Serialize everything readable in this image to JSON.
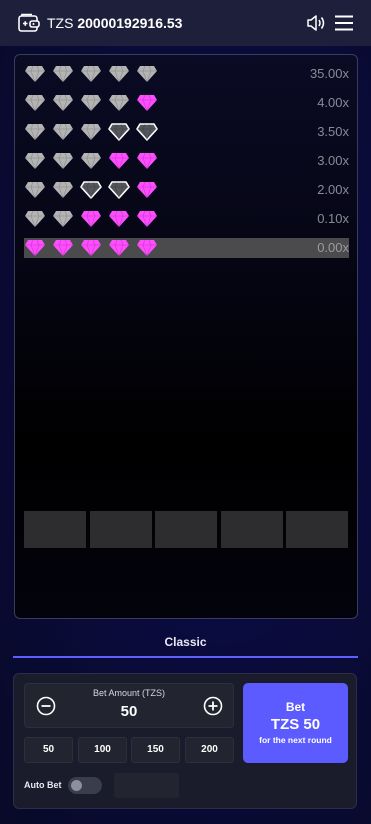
{
  "header": {
    "currency": "TZS",
    "balance": "20000192916.53",
    "icons": [
      "wallet-icon",
      "sound-icon",
      "menu-icon"
    ]
  },
  "colors": {
    "gem_pink": "#ff4dff",
    "gem_grey": "#b4b4b4",
    "gem_outline": "#ffffff",
    "accent": "#5c5bff",
    "active_row": "#4b4b4e"
  },
  "paytable": [
    {
      "multiplier": "35.00x",
      "gems": [
        "grey",
        "grey",
        "grey",
        "grey",
        "grey"
      ],
      "active": false
    },
    {
      "multiplier": "4.00x",
      "gems": [
        "grey",
        "grey",
        "grey",
        "grey",
        "pink"
      ],
      "active": false
    },
    {
      "multiplier": "3.50x",
      "gems": [
        "grey",
        "grey",
        "grey",
        "outline",
        "outline"
      ],
      "active": false
    },
    {
      "multiplier": "3.00x",
      "gems": [
        "grey",
        "grey",
        "grey",
        "pink",
        "pink"
      ],
      "active": false
    },
    {
      "multiplier": "2.00x",
      "gems": [
        "grey",
        "grey",
        "outline",
        "outline",
        "pink"
      ],
      "active": false
    },
    {
      "multiplier": "0.10x",
      "gems": [
        "grey",
        "grey",
        "pink",
        "pink",
        "pink"
      ],
      "active": false
    },
    {
      "multiplier": "0.00x",
      "gems": [
        "pink",
        "pink",
        "pink",
        "pink",
        "pink"
      ],
      "active": true
    }
  ],
  "slots_count": 5,
  "mode": {
    "label": "Classic"
  },
  "bet": {
    "amount_label": "Bet Amount (TZS)",
    "amount_value": "50",
    "quick_amounts": [
      "50",
      "100",
      "150",
      "200"
    ],
    "button_title": "Bet",
    "button_amount": "TZS 50",
    "button_sub": "for the next round"
  },
  "auto_bet": {
    "label": "Auto Bet",
    "enabled": false
  }
}
